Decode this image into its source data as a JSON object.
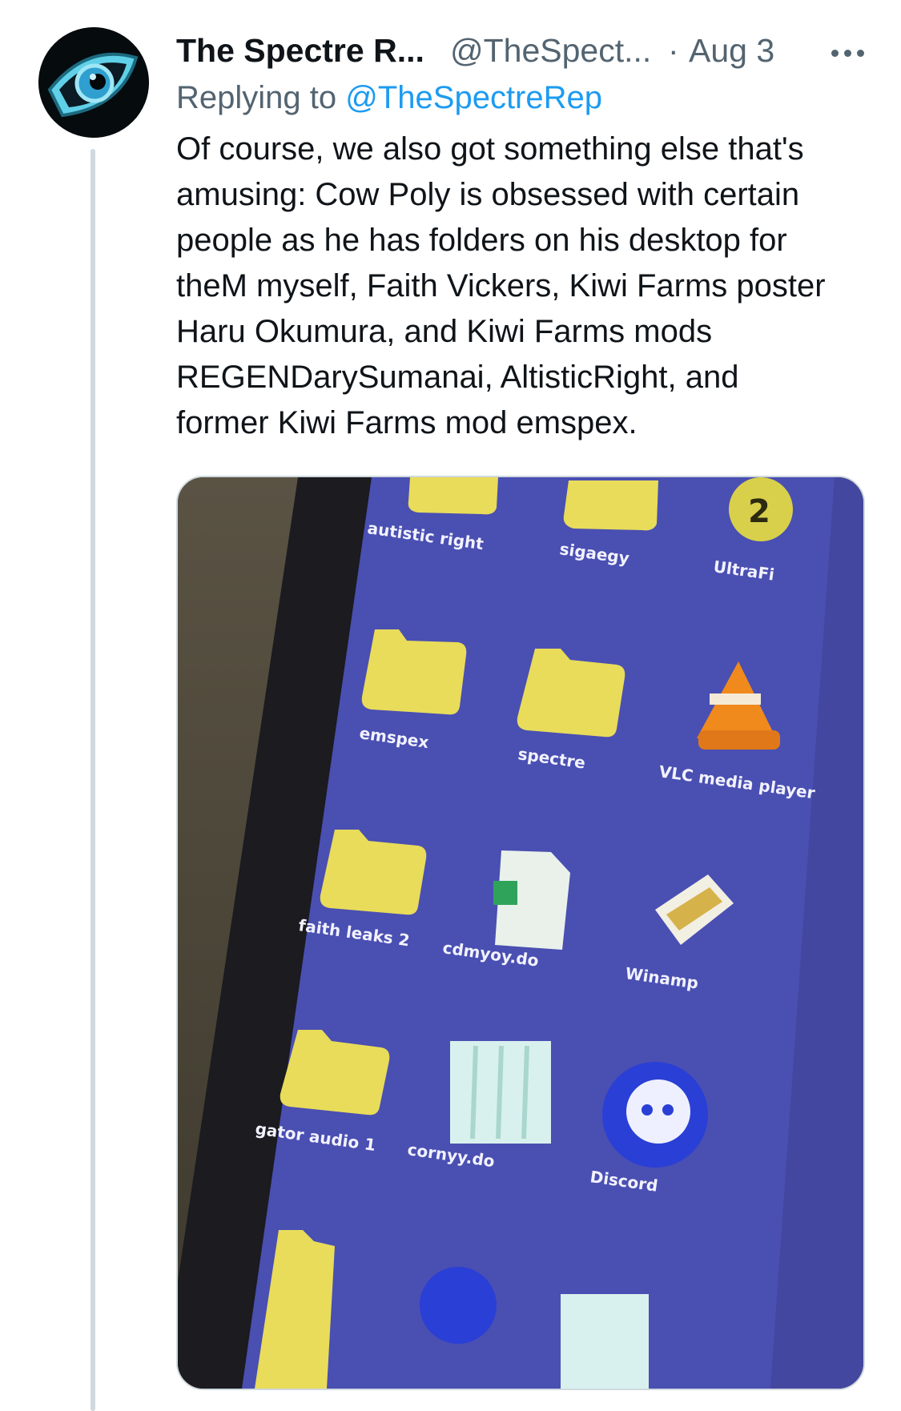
{
  "tweet": {
    "display_name": "The Spectre R...",
    "handle": "@TheSpect...",
    "separator": "·",
    "timestamp": "Aug 3",
    "replying_prefix": "Replying to ",
    "replying_handle": "@TheSpectreRep",
    "text": "Of course, we also got something else that's\namusing: Cow Poly is obsessed with certain\npeople as he has folders on his desktop for\ntheM myself, Faith Vickers, Kiwi Farms poster\nHaru Okumura, and Kiwi Farms mods\nREGENDarySumanai, AltisticRight, and\nformer Kiwi Farms mod emspex."
  },
  "avatar": {
    "icon": "eye-logo-icon"
  },
  "media": {
    "desktop_labels": [
      "autistic right",
      "sigaegy",
      "UltraFi",
      "emspex",
      "spectre",
      "VLC media player",
      "faith leaks 2",
      "cdmyoy.do",
      "Winamp",
      "gator audio 1",
      "cornyy.do",
      "Discord"
    ],
    "colors": {
      "desktop": "#4a4fb2",
      "folder": "#e8dc5a",
      "vlc_cone": "#f08a1c",
      "discord": "#2a3fd6",
      "excel": "#2fa35a"
    }
  }
}
